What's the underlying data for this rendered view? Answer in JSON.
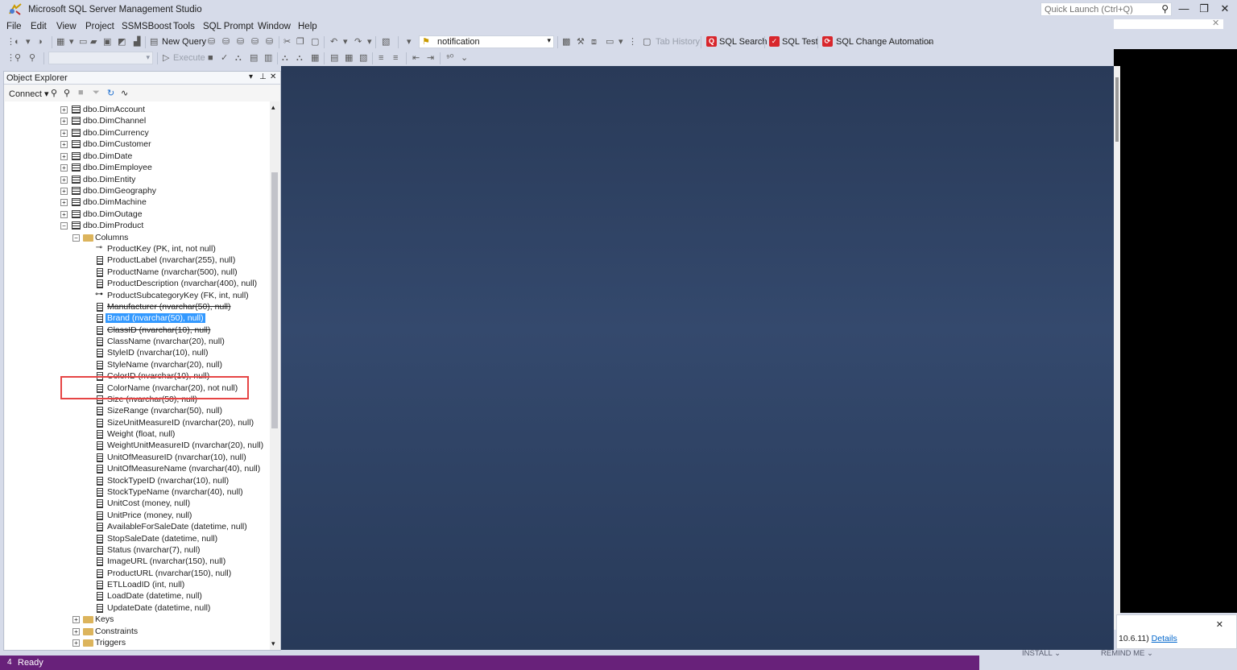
{
  "window": {
    "title": "Microsoft SQL Server Management Studio",
    "quick_launch_placeholder": "Quick Launch (Ctrl+Q)",
    "minimize_glyph": "—",
    "restore_glyph": "❐",
    "close_glyph": "✕"
  },
  "menu": [
    "File",
    "Edit",
    "View",
    "Project",
    "SSMSBoost",
    "Tools",
    "SQL Prompt",
    "Window",
    "Help"
  ],
  "toolbar1": {
    "new_query_label": "New Query",
    "database_value": "notification",
    "tab_history_label": "Tab History",
    "sql_search_label": "SQL Search",
    "sql_test_label": "SQL Test",
    "sql_change_automation_label": "SQL Change Automation"
  },
  "toolbar2": {
    "execute_label": "Execute"
  },
  "object_explorer": {
    "title": "Object Explorer",
    "pin_glyph": "ᵮ",
    "close_glyph": "✕",
    "dropdown_glyph": "▾",
    "connect_label": "Connect ▾",
    "tables": [
      "dbo.DimAccount",
      "dbo.DimChannel",
      "dbo.DimCurrency",
      "dbo.DimCustomer",
      "dbo.DimDate",
      "dbo.DimEmployee",
      "dbo.DimEntity",
      "dbo.DimGeography",
      "dbo.DimMachine",
      "dbo.DimOutage",
      "dbo.DimProduct"
    ],
    "columns_folder": "Columns",
    "columns": [
      {
        "label": "ProductKey (PK, int, not null)",
        "icon": "primary-key"
      },
      {
        "label": "ProductLabel (nvarchar(255), null)",
        "icon": "column"
      },
      {
        "label": "ProductName (nvarchar(500), null)",
        "icon": "column"
      },
      {
        "label": "ProductDescription (nvarchar(400), null)",
        "icon": "column"
      },
      {
        "label": "ProductSubcategoryKey (FK, int, null)",
        "icon": "foreign-key"
      },
      {
        "label": "Manufacturer (nvarchar(50), null)",
        "icon": "column"
      },
      {
        "label": "Brand (nvarchar(50), null)",
        "icon": "column",
        "selected": true
      },
      {
        "label": "ClassID (nvarchar(10), null)",
        "icon": "column"
      },
      {
        "label": "ClassName (nvarchar(20), null)",
        "icon": "column"
      },
      {
        "label": "StyleID (nvarchar(10), null)",
        "icon": "column"
      },
      {
        "label": "StyleName (nvarchar(20), null)",
        "icon": "column"
      },
      {
        "label": "ColorID (nvarchar(10), null)",
        "icon": "column"
      },
      {
        "label": "ColorName (nvarchar(20), not null)",
        "icon": "column"
      },
      {
        "label": "Size (nvarchar(50), null)",
        "icon": "column"
      },
      {
        "label": "SizeRange (nvarchar(50), null)",
        "icon": "column"
      },
      {
        "label": "SizeUnitMeasureID (nvarchar(20), null)",
        "icon": "column"
      },
      {
        "label": "Weight (float, null)",
        "icon": "column"
      },
      {
        "label": "WeightUnitMeasureID (nvarchar(20), null)",
        "icon": "column"
      },
      {
        "label": "UnitOfMeasureID (nvarchar(10), null)",
        "icon": "column"
      },
      {
        "label": "UnitOfMeasureName (nvarchar(40), null)",
        "icon": "column"
      },
      {
        "label": "StockTypeID (nvarchar(10), null)",
        "icon": "column"
      },
      {
        "label": "StockTypeName (nvarchar(40), null)",
        "icon": "column"
      },
      {
        "label": "UnitCost (money, null)",
        "icon": "column"
      },
      {
        "label": "UnitPrice (money, null)",
        "icon": "column"
      },
      {
        "label": "AvailableForSaleDate (datetime, null)",
        "icon": "column"
      },
      {
        "label": "StopSaleDate (datetime, null)",
        "icon": "column"
      },
      {
        "label": "Status (nvarchar(7), null)",
        "icon": "column"
      },
      {
        "label": "ImageURL (nvarchar(150), null)",
        "icon": "column"
      },
      {
        "label": "ProductURL (nvarchar(150), null)",
        "icon": "column"
      },
      {
        "label": "ETLLoadID (int, null)",
        "icon": "column"
      },
      {
        "label": "LoadDate (datetime, null)",
        "icon": "column"
      },
      {
        "label": "UpdateDate (datetime, null)",
        "icon": "column"
      }
    ],
    "sub_folders": [
      "Keys",
      "Constraints",
      "Triggers"
    ]
  },
  "status": {
    "number": "4",
    "text": "Ready"
  },
  "notification": {
    "text": "10.6.11)",
    "link": "Details",
    "install_label": "INSTALL ⌄",
    "remind_label": "REMIND ME ⌄"
  },
  "colors": {
    "status_bar": "#68217a",
    "workspace": "#2f4266",
    "selection": "#3399ff",
    "highlight_box": "#e64545"
  }
}
